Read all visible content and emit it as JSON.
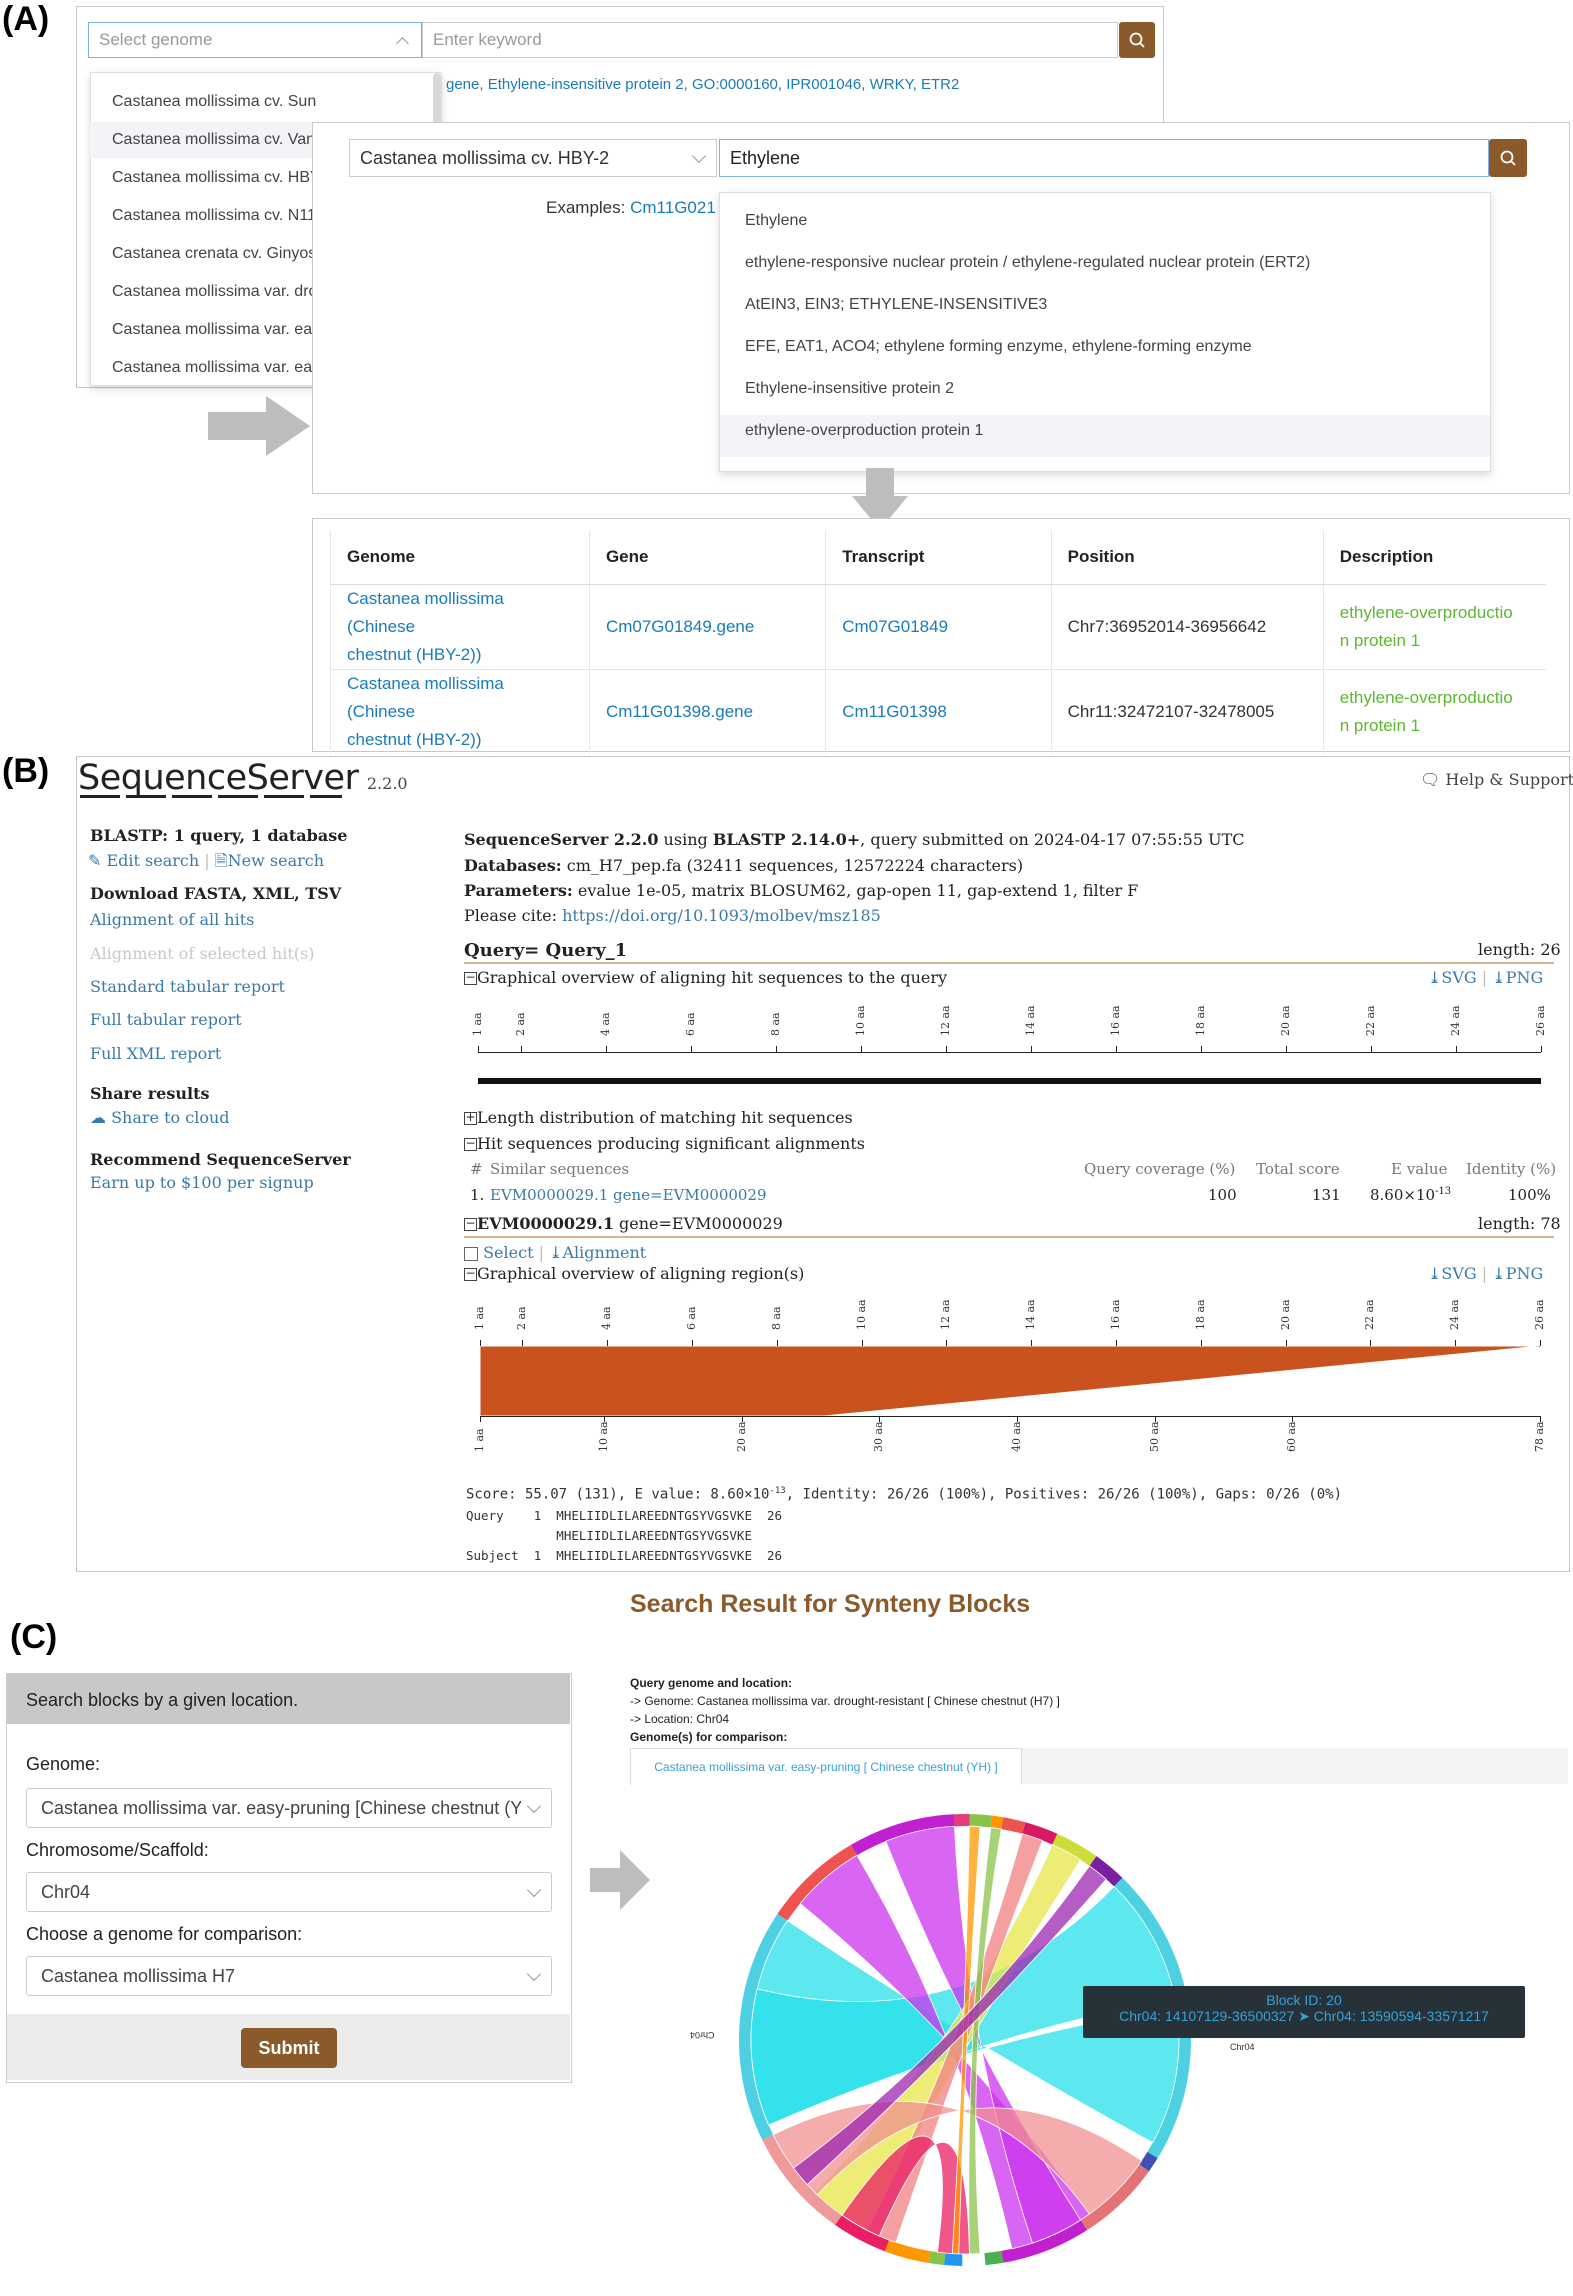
{
  "labels": {
    "a": "(A)",
    "b": "(B)",
    "c": "(C)"
  },
  "panel_a": {
    "search1": {
      "genome_placeholder": "Select genome",
      "keyword_placeholder": "Enter keyword"
    },
    "examples_tail": "gene, Ethylene-insensitive protein 2, GO:0000160, IPR001046, WRKY, ETR2",
    "genome_options": [
      "Castanea mollissima cv. Sun",
      "Castanea mollissima cv. Van",
      "Castanea mollissima cv. HBY",
      "Castanea mollissima cv. N11",
      "Castanea crenata cv. Ginyos",
      "Castanea mollissima var. dro",
      "Castanea mollissima var. eas",
      "Castanea mollissima var. ear"
    ],
    "search2": {
      "genome_value": "Castanea mollissima cv. HBY-2",
      "keyword_value": "Ethylene"
    },
    "examples_label": "Examples:",
    "examples_link": "Cm11G021",
    "suggestions": [
      "Ethylene",
      "ethylene-responsive nuclear protein / ethylene-regulated nuclear protein (ERT2)",
      "AtEIN3, EIN3; ETHYLENE-INSENSITIVE3",
      "EFE, EAT1, ACO4; ethylene forming enzyme, ethylene-forming enzyme",
      "Ethylene-insensitive protein 2",
      "ethylene-overproduction protein 1"
    ],
    "table": {
      "headers": [
        "Genome",
        "Gene",
        "Transcript",
        "Position",
        "Description"
      ],
      "rows": [
        {
          "genome1": "Castanea mollissima (Chinese",
          "genome2": "chestnut (HBY-2))",
          "gene": "Cm07G01849.gene",
          "transcript": "Cm07G01849",
          "position": "Chr7:36952014-36956642",
          "desc1": "ethylene-overproductio",
          "desc2": "n protein 1"
        },
        {
          "genome1": "Castanea mollissima (Chinese",
          "genome2": "chestnut (HBY-2))",
          "gene": "Cm11G01398.gene",
          "transcript": "Cm11G01398",
          "position": "Chr11:32472107-32478005",
          "desc1": "ethylene-overproductio",
          "desc2": "n protein 1"
        }
      ]
    }
  },
  "panel_b": {
    "logo": "SequenceServer",
    "version": "2.2.0",
    "help": "Help & Support",
    "sidebar": {
      "blastp_title": "BLASTP: 1 query, 1 database",
      "edit_search": "Edit search",
      "new_search": "New search",
      "download_title": "Download FASTA, XML, TSV",
      "alignment_all": "Alignment of all hits",
      "alignment_selected": "Alignment of selected hit(s)",
      "std_tabular": "Standard tabular report",
      "full_tabular": "Full tabular report",
      "full_xml": "Full XML report",
      "share_title": "Share results",
      "share_cloud": "Share to cloud",
      "recommend_title": "Recommend SequenceServer",
      "earn": "Earn up to $100 per signup"
    },
    "header": {
      "l1_bold1": "SequenceServer 2.2.0",
      "l1_mid": " using ",
      "l1_bold2": "BLASTP 2.14.0+",
      "l1_tail": ", query submitted on 2024-04-17 07:55:55 UTC",
      "l2_bold": "Databases:",
      "l2_text": " cm_H7_pep.fa (32411 sequences, 12572224 characters)",
      "l3_bold": "Parameters:",
      "l3_text": " evalue 1e-05, matrix BLOSUM62, gap-open 11, gap-extend 1, filter F",
      "l4_text": "Please cite: ",
      "l4_link": "https://doi.org/10.1093/molbev/msz185"
    },
    "query": {
      "title": "Query= Query_1",
      "length": "length: 26",
      "overview": "Graphical overview of aligning hit sequences to the query",
      "svg": "SVG",
      "png": "PNG"
    },
    "query_ticks": [
      "1 aa",
      "2 aa",
      "4 aa",
      "6 aa",
      "8 aa",
      "10 aa",
      "12 aa",
      "14 aa",
      "16 aa",
      "18 aa",
      "20 aa",
      "22 aa",
      "24 aa",
      "26 aa"
    ],
    "length_dist": "Length distribution of matching hit sequences",
    "hit_seqs": "Hit sequences producing significant alignments",
    "hits_table": {
      "headers": [
        "#",
        "Similar sequences",
        "Query coverage (%)",
        "Total score",
        "E value",
        "Identity (%)"
      ],
      "row": {
        "num": "1.",
        "name": "EVM0000029.1 gene=EVM0000029",
        "coverage": "100",
        "score": "131",
        "evalue": "8.60×10",
        "evalue_exp": "-13",
        "identity": "100%"
      }
    },
    "hit": {
      "id": "EVM0000029.1",
      "desc": " gene=EVM0000029",
      "length": "length: 78",
      "select": "Select",
      "alignment": "Alignment",
      "overview": "Graphical overview of aligning region(s)"
    },
    "hit_ticks_top": [
      "1 aa",
      "2 aa",
      "4 aa",
      "6 aa",
      "8 aa",
      "10 aa",
      "12 aa",
      "14 aa",
      "16 aa",
      "18 aa",
      "20 aa",
      "22 aa",
      "24 aa",
      "26 aa"
    ],
    "hit_ticks_bottom": [
      "1 aa",
      "10 aa",
      "20 aa",
      "30 aa",
      "40 aa",
      "50 aa",
      "60 aa",
      "78 aa"
    ],
    "alignment_region": {
      "query_from": 1,
      "query_to": 26,
      "query_length": 26,
      "subject_from": 1,
      "subject_to": 26,
      "subject_length": 78,
      "color": "#c9521e"
    },
    "score_line": "Score: 55.07 (131), E value: 8.60×10",
    "score_exp": "-13",
    "score_tail": ", Identity: 26/26 (100%), Positives: 26/26 (100%), Gaps: 0/26 (0%)",
    "aln": {
      "q": "Query    1  MHELIIDLILAREEDNTGSYVGSVKE  26",
      "m": "            MHELIIDLILAREEDNTGSYVGSVKE",
      "s": "Subject  1  MHELIIDLILAREEDNTGSYVGSVKE  26"
    }
  },
  "panel_c": {
    "title": "Search Result for Synteny Blocks",
    "form_header": "Search blocks by a given location.",
    "genome_label": "Genome:",
    "genome_value": "Castanea mollissima var. easy-pruning [Chinese chestnut (YI",
    "chrom_label": "Chromosome/Scaffold:",
    "chrom_value": "Chr04",
    "compare_label": "Choose a genome for comparison:",
    "compare_value": "Castanea mollissima H7",
    "submit": "Submit",
    "query_info_title": "Query genome and location:",
    "query_genome": "-> Genome: Castanea mollissima var. drought-resistant [ Chinese chestnut (H7) ]",
    "query_location": "-> Location: Chr04",
    "compare_title": "Genome(s) for comparison:",
    "compare_tab": "Castanea mollissima var. easy-pruning [ Chinese chestnut (YH) ]",
    "tooltip_title": "Block ID: 20",
    "tooltip_body": "Chr04: 14107129-36500327 ➤ Chr04: 13590594-33571217",
    "chr_label_left": "Chr04",
    "chr_label_right": "Chr04"
  },
  "colors": {
    "brand_brown": "#8a5a2b",
    "link_blue": "#1a7bb9",
    "green": "#5cb82e",
    "ss_orange": "#c9521e"
  }
}
